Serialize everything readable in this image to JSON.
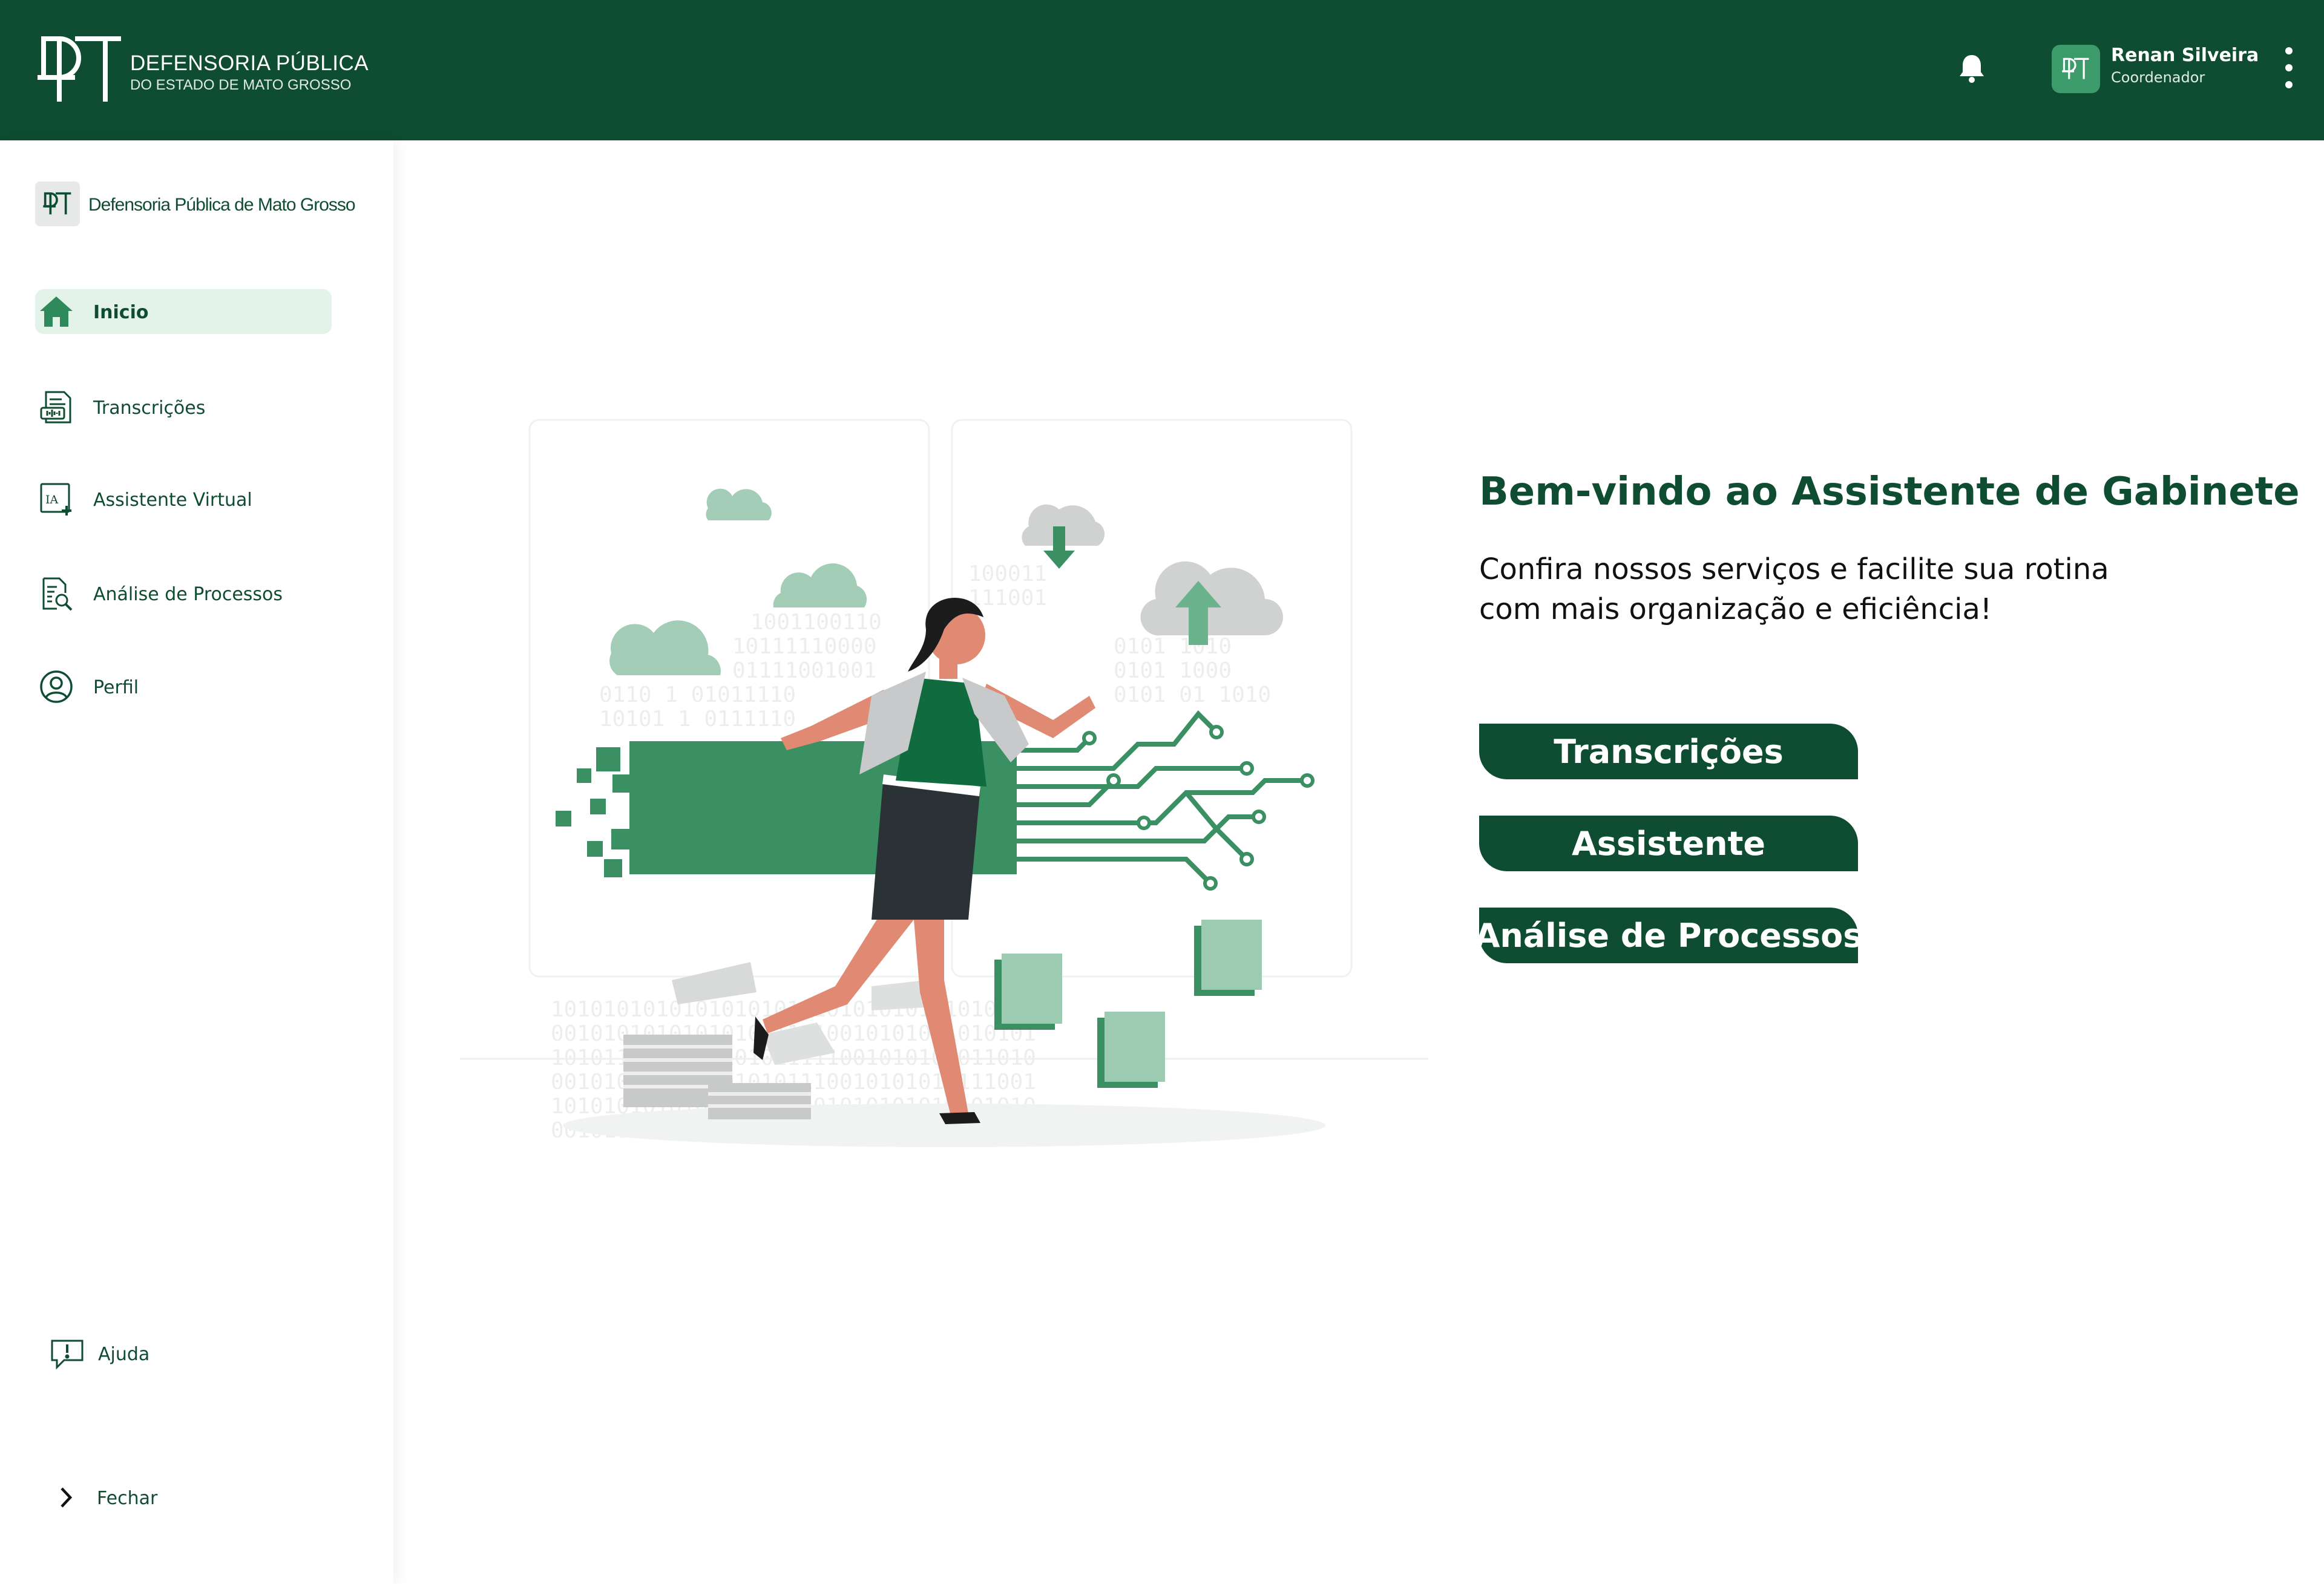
{
  "header": {
    "brand_title": "DEFENSORIA PÚBLICA",
    "brand_subtitle": "DO ESTADO DE MATO GROSSO",
    "notification_icon": "bell-icon",
    "user": {
      "name": "Renan Silveira",
      "role": "Coordenador"
    },
    "menu_icon": "kebab-menu-icon"
  },
  "sidebar": {
    "org_name": "Defensoria Pública de Mato Grosso",
    "items": [
      {
        "label": "Inicio",
        "icon": "home-icon",
        "active": true
      },
      {
        "label": "Transcrições",
        "icon": "transcription-icon",
        "active": false
      },
      {
        "label": "Assistente Virtual",
        "icon": "ai-assistant-icon",
        "active": false
      },
      {
        "label": "Análise de Processos",
        "icon": "document-search-icon",
        "active": false
      },
      {
        "label": "Perfil",
        "icon": "user-circle-icon",
        "active": false
      }
    ],
    "help_label": "Ajuda",
    "close_label": "Fechar"
  },
  "main": {
    "title": "Bem-vindo ao Assistente de Gabinete",
    "subtitle": "Confira nossos serviços e facilite sua rotina com mais organização e eficiência!",
    "buttons": [
      {
        "label": "Transcrições"
      },
      {
        "label": "Assistente"
      },
      {
        "label": "Análise de Processos"
      }
    ]
  },
  "colors": {
    "primary": "#0f4d33",
    "accent": "#3d9a6b",
    "active_bg": "#e4f3ea",
    "illustration_green": "#3a8f63",
    "illustration_light_green": "#9ccbb2"
  }
}
